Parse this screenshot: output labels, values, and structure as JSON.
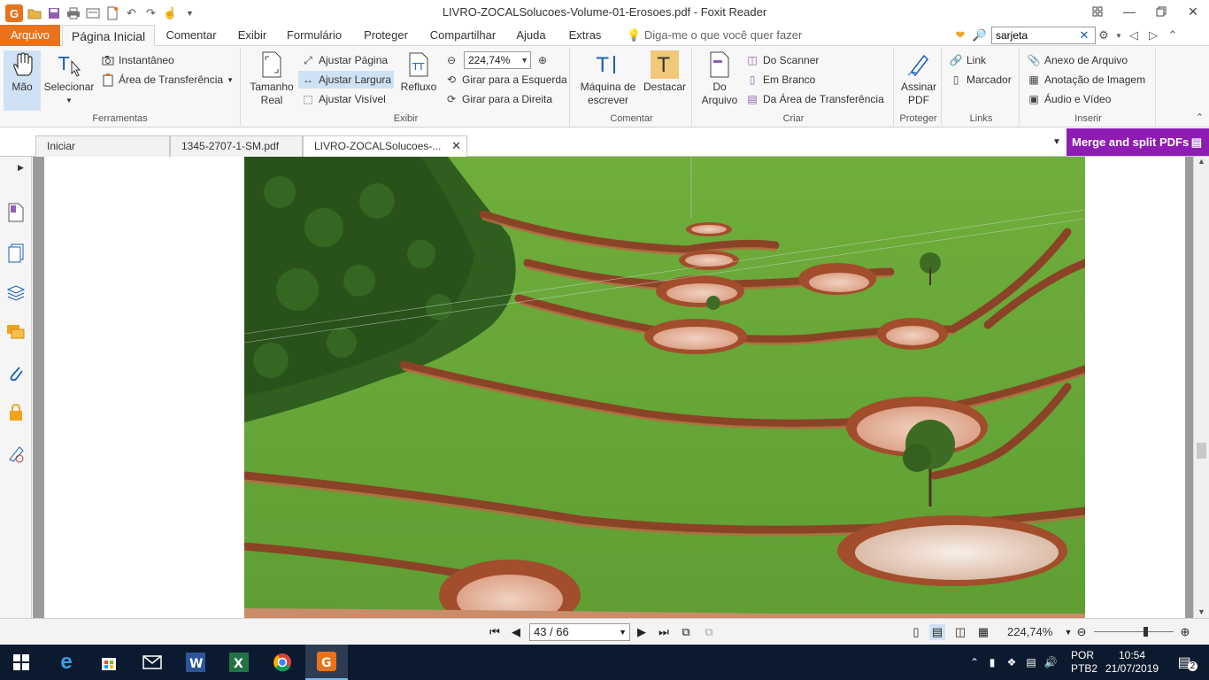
{
  "window": {
    "title": "LIVRO-ZOCALSolucoes-Volume-01-Erosoes.pdf - Foxit Reader",
    "app_logo_letter": "G"
  },
  "menu": {
    "file": "Arquivo",
    "tabs": [
      "Página Inicial",
      "Comentar",
      "Exibir",
      "Formulário",
      "Proteger",
      "Compartilhar",
      "Ajuda",
      "Extras"
    ],
    "tell_me": "Diga-me o que você quer fazer",
    "search_value": "sarjeta"
  },
  "ribbon": {
    "ferramentas": {
      "label": "Ferramentas",
      "hand": "Mão",
      "select": "Selecionar",
      "snapshot": "Instantâneo",
      "clipboard": "Área de Transferência"
    },
    "exibir": {
      "label": "Exibir",
      "actual_size_1": "Tamanho",
      "actual_size_2": "Real",
      "fit_page": "Ajustar Página",
      "fit_width": "Ajustar Largura",
      "fit_visible": "Ajustar Visível",
      "reflow": "Refluxo",
      "zoom_value": "224,74%",
      "rotate_left": "Girar para a Esquerda",
      "rotate_right": "Girar para a Direita"
    },
    "comentar": {
      "label": "Comentar",
      "typewriter_1": "Máquina de",
      "typewriter_2": "escrever",
      "highlight": "Destacar"
    },
    "criar": {
      "label": "Criar",
      "from_file_1": "Do",
      "from_file_2": "Arquivo",
      "from_scanner": "Do Scanner",
      "blank": "Em Branco",
      "from_clipboard": "Da Área de Transferência"
    },
    "proteger": {
      "label": "Proteger",
      "sign_1": "Assinar",
      "sign_2": "PDF"
    },
    "links": {
      "label": "Links",
      "link": "Link",
      "bookmark": "Marcador"
    },
    "inserir": {
      "label": "Inserir",
      "file_attachment": "Anexo de Arquivo",
      "image_annotation": "Anotação de Imagem",
      "audio_video": "Áudio e Vídeo"
    }
  },
  "doc_tabs": [
    "Iniciar",
    "1345-2707-1-SM.pdf",
    "LIVRO-ZOCALSolucoes-..."
  ],
  "merge_button": "Merge and split PDFs",
  "status": {
    "page_indicator": "43 / 66",
    "zoom": "224,74%",
    "zoom_slider_fraction": 0.62
  },
  "taskbar": {
    "language_1": "POR",
    "language_2": "PTB2",
    "time": "10:54",
    "date": "21/07/2019",
    "notification_count": "2",
    "apps": [
      "windows-start",
      "edge",
      "store",
      "mail",
      "word",
      "excel",
      "chrome",
      "foxit"
    ]
  },
  "colors": {
    "accent_orange": "#e8731c",
    "merge_purple": "#8e1cb4",
    "taskbar": "#0b1a2e"
  }
}
